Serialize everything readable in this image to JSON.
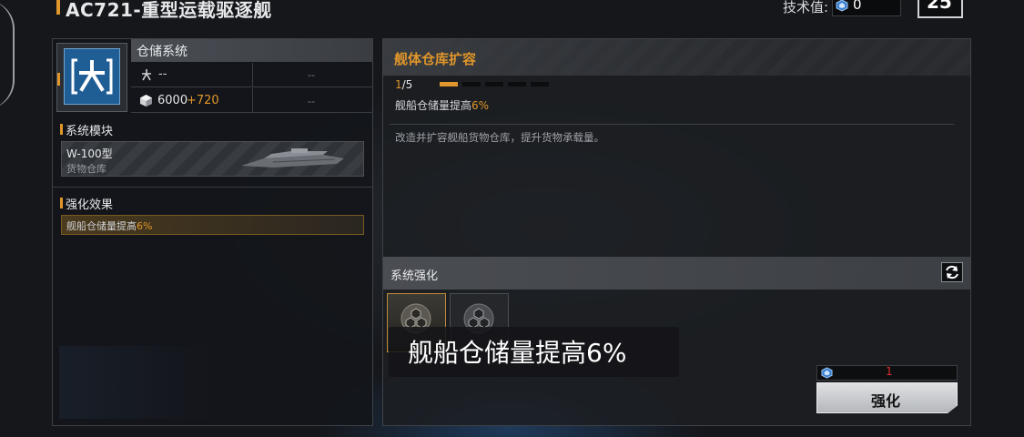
{
  "header": {
    "title": "AC721-重型运载驱逐舰",
    "tech_label": "技术值:",
    "tech_value": "0",
    "level": "25"
  },
  "left_panel": {
    "system_name": "仓储系统",
    "stat1": {
      "icon": "branch-icon",
      "value": "--",
      "right": "--"
    },
    "stat2": {
      "icon": "cargo-cube-icon",
      "base": "6000",
      "bonus": "+720",
      "right": "--"
    },
    "modules_heading": "系统模块",
    "module": {
      "name": "W-100型",
      "type": "货物仓库"
    },
    "effects_heading": "强化效果",
    "effect_prefix": "舰船仓储量提高",
    "effect_value": "6%"
  },
  "right_panel": {
    "upgrade_title": "舰体仓库扩容",
    "progress_current": "1",
    "progress_total": "/5",
    "progress": {
      "filled": 1,
      "total": 5
    },
    "effect_prefix": "舰船仓储量提高",
    "effect_value": "6%",
    "description": "改造并扩容舰船货物仓库，提升货物承载量。",
    "enhance_section_title": "系统强化",
    "subtitle": "舰船仓储量提高6%",
    "cost_value": "1",
    "enhance_button": "强化"
  },
  "colors": {
    "accent": "#e0962a",
    "icon_blue": "#1f5d95",
    "cost_red": "#e03030"
  }
}
